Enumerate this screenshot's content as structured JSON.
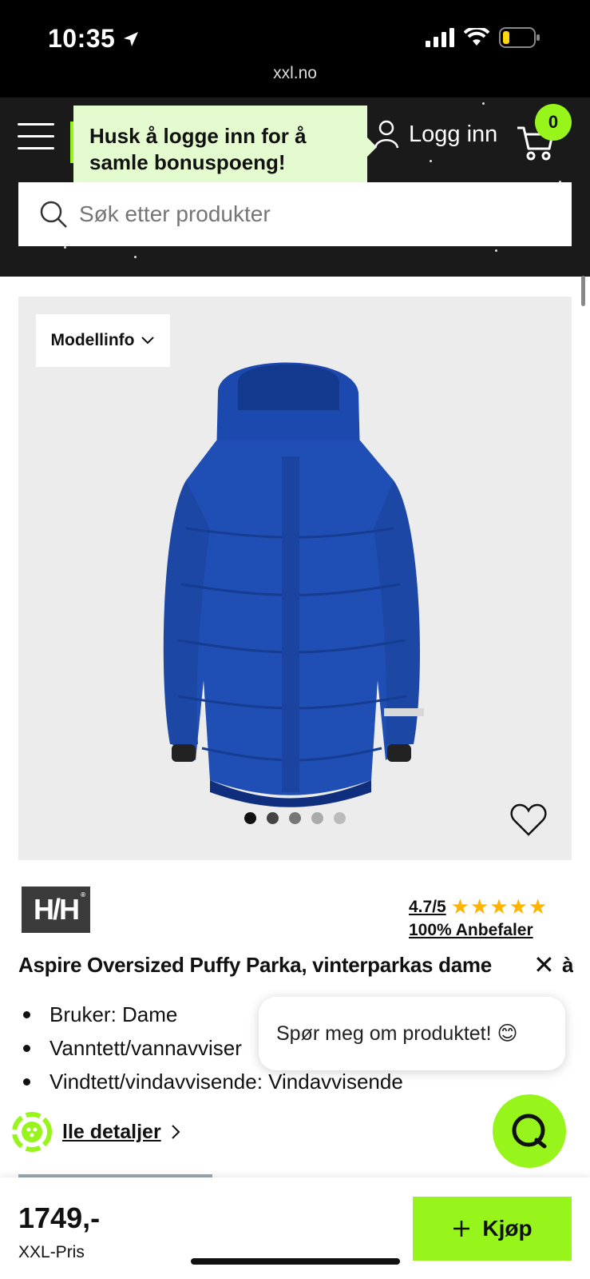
{
  "status_bar": {
    "time": "10:35",
    "url": "xxl.no"
  },
  "header": {
    "tooltip": "Husk å logge inn for å samle bonuspoeng!",
    "login_label": "Logg inn",
    "cart_count": "0",
    "search_placeholder": "Søk etter produkter"
  },
  "gallery": {
    "modellinfo_label": "Modellinfo",
    "dots": [
      {
        "color": "#111111",
        "active": true
      },
      {
        "color": "#444444",
        "active": false
      },
      {
        "color": "#777777",
        "active": false
      },
      {
        "color": "#aaaaaa",
        "active": false
      },
      {
        "color": "#bbbbbb",
        "active": false
      }
    ],
    "jacket_color": "#1f4fb5"
  },
  "product": {
    "brand": "H/H",
    "rating": "4.7/5",
    "stars": "★★★★★",
    "recommend": "100% Anbefaler",
    "title": "Aspire Oversized Puffy Parka, vinterparkas dame",
    "title_overflow": "à",
    "features": [
      "Bruker: Dame",
      "Vanntett/vannavviser",
      "Vindtett/vindavvisende: Vindavvisende"
    ],
    "details_label": "lle detaljer"
  },
  "chat": {
    "bubble_text": "Spør meg om produktet! 😊"
  },
  "purchase": {
    "price": "1749,-",
    "price_label": "XXL-Pris",
    "buy_label": "Kjøp"
  },
  "colors": {
    "accent": "#98f51b",
    "header_bg": "#1a1a1a",
    "tooltip_bg": "#e4fbcf"
  }
}
